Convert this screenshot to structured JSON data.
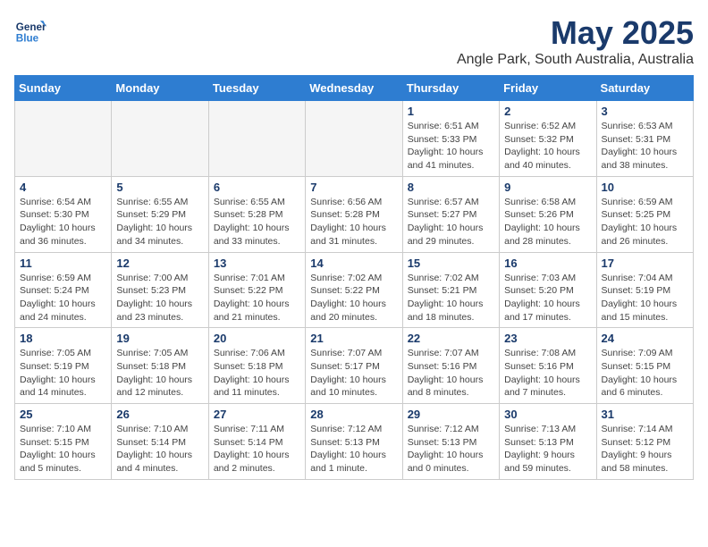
{
  "header": {
    "logo_line1": "General",
    "logo_line2": "Blue",
    "month": "May 2025",
    "location": "Angle Park, South Australia, Australia"
  },
  "weekdays": [
    "Sunday",
    "Monday",
    "Tuesday",
    "Wednesday",
    "Thursday",
    "Friday",
    "Saturday"
  ],
  "weeks": [
    [
      {
        "day": "",
        "info": ""
      },
      {
        "day": "",
        "info": ""
      },
      {
        "day": "",
        "info": ""
      },
      {
        "day": "",
        "info": ""
      },
      {
        "day": "1",
        "info": "Sunrise: 6:51 AM\nSunset: 5:33 PM\nDaylight: 10 hours\nand 41 minutes."
      },
      {
        "day": "2",
        "info": "Sunrise: 6:52 AM\nSunset: 5:32 PM\nDaylight: 10 hours\nand 40 minutes."
      },
      {
        "day": "3",
        "info": "Sunrise: 6:53 AM\nSunset: 5:31 PM\nDaylight: 10 hours\nand 38 minutes."
      }
    ],
    [
      {
        "day": "4",
        "info": "Sunrise: 6:54 AM\nSunset: 5:30 PM\nDaylight: 10 hours\nand 36 minutes."
      },
      {
        "day": "5",
        "info": "Sunrise: 6:55 AM\nSunset: 5:29 PM\nDaylight: 10 hours\nand 34 minutes."
      },
      {
        "day": "6",
        "info": "Sunrise: 6:55 AM\nSunset: 5:28 PM\nDaylight: 10 hours\nand 33 minutes."
      },
      {
        "day": "7",
        "info": "Sunrise: 6:56 AM\nSunset: 5:28 PM\nDaylight: 10 hours\nand 31 minutes."
      },
      {
        "day": "8",
        "info": "Sunrise: 6:57 AM\nSunset: 5:27 PM\nDaylight: 10 hours\nand 29 minutes."
      },
      {
        "day": "9",
        "info": "Sunrise: 6:58 AM\nSunset: 5:26 PM\nDaylight: 10 hours\nand 28 minutes."
      },
      {
        "day": "10",
        "info": "Sunrise: 6:59 AM\nSunset: 5:25 PM\nDaylight: 10 hours\nand 26 minutes."
      }
    ],
    [
      {
        "day": "11",
        "info": "Sunrise: 6:59 AM\nSunset: 5:24 PM\nDaylight: 10 hours\nand 24 minutes."
      },
      {
        "day": "12",
        "info": "Sunrise: 7:00 AM\nSunset: 5:23 PM\nDaylight: 10 hours\nand 23 minutes."
      },
      {
        "day": "13",
        "info": "Sunrise: 7:01 AM\nSunset: 5:22 PM\nDaylight: 10 hours\nand 21 minutes."
      },
      {
        "day": "14",
        "info": "Sunrise: 7:02 AM\nSunset: 5:22 PM\nDaylight: 10 hours\nand 20 minutes."
      },
      {
        "day": "15",
        "info": "Sunrise: 7:02 AM\nSunset: 5:21 PM\nDaylight: 10 hours\nand 18 minutes."
      },
      {
        "day": "16",
        "info": "Sunrise: 7:03 AM\nSunset: 5:20 PM\nDaylight: 10 hours\nand 17 minutes."
      },
      {
        "day": "17",
        "info": "Sunrise: 7:04 AM\nSunset: 5:19 PM\nDaylight: 10 hours\nand 15 minutes."
      }
    ],
    [
      {
        "day": "18",
        "info": "Sunrise: 7:05 AM\nSunset: 5:19 PM\nDaylight: 10 hours\nand 14 minutes."
      },
      {
        "day": "19",
        "info": "Sunrise: 7:05 AM\nSunset: 5:18 PM\nDaylight: 10 hours\nand 12 minutes."
      },
      {
        "day": "20",
        "info": "Sunrise: 7:06 AM\nSunset: 5:18 PM\nDaylight: 10 hours\nand 11 minutes."
      },
      {
        "day": "21",
        "info": "Sunrise: 7:07 AM\nSunset: 5:17 PM\nDaylight: 10 hours\nand 10 minutes."
      },
      {
        "day": "22",
        "info": "Sunrise: 7:07 AM\nSunset: 5:16 PM\nDaylight: 10 hours\nand 8 minutes."
      },
      {
        "day": "23",
        "info": "Sunrise: 7:08 AM\nSunset: 5:16 PM\nDaylight: 10 hours\nand 7 minutes."
      },
      {
        "day": "24",
        "info": "Sunrise: 7:09 AM\nSunset: 5:15 PM\nDaylight: 10 hours\nand 6 minutes."
      }
    ],
    [
      {
        "day": "25",
        "info": "Sunrise: 7:10 AM\nSunset: 5:15 PM\nDaylight: 10 hours\nand 5 minutes."
      },
      {
        "day": "26",
        "info": "Sunrise: 7:10 AM\nSunset: 5:14 PM\nDaylight: 10 hours\nand 4 minutes."
      },
      {
        "day": "27",
        "info": "Sunrise: 7:11 AM\nSunset: 5:14 PM\nDaylight: 10 hours\nand 2 minutes."
      },
      {
        "day": "28",
        "info": "Sunrise: 7:12 AM\nSunset: 5:13 PM\nDaylight: 10 hours\nand 1 minute."
      },
      {
        "day": "29",
        "info": "Sunrise: 7:12 AM\nSunset: 5:13 PM\nDaylight: 10 hours\nand 0 minutes."
      },
      {
        "day": "30",
        "info": "Sunrise: 7:13 AM\nSunset: 5:13 PM\nDaylight: 9 hours\nand 59 minutes."
      },
      {
        "day": "31",
        "info": "Sunrise: 7:14 AM\nSunset: 5:12 PM\nDaylight: 9 hours\nand 58 minutes."
      }
    ]
  ]
}
